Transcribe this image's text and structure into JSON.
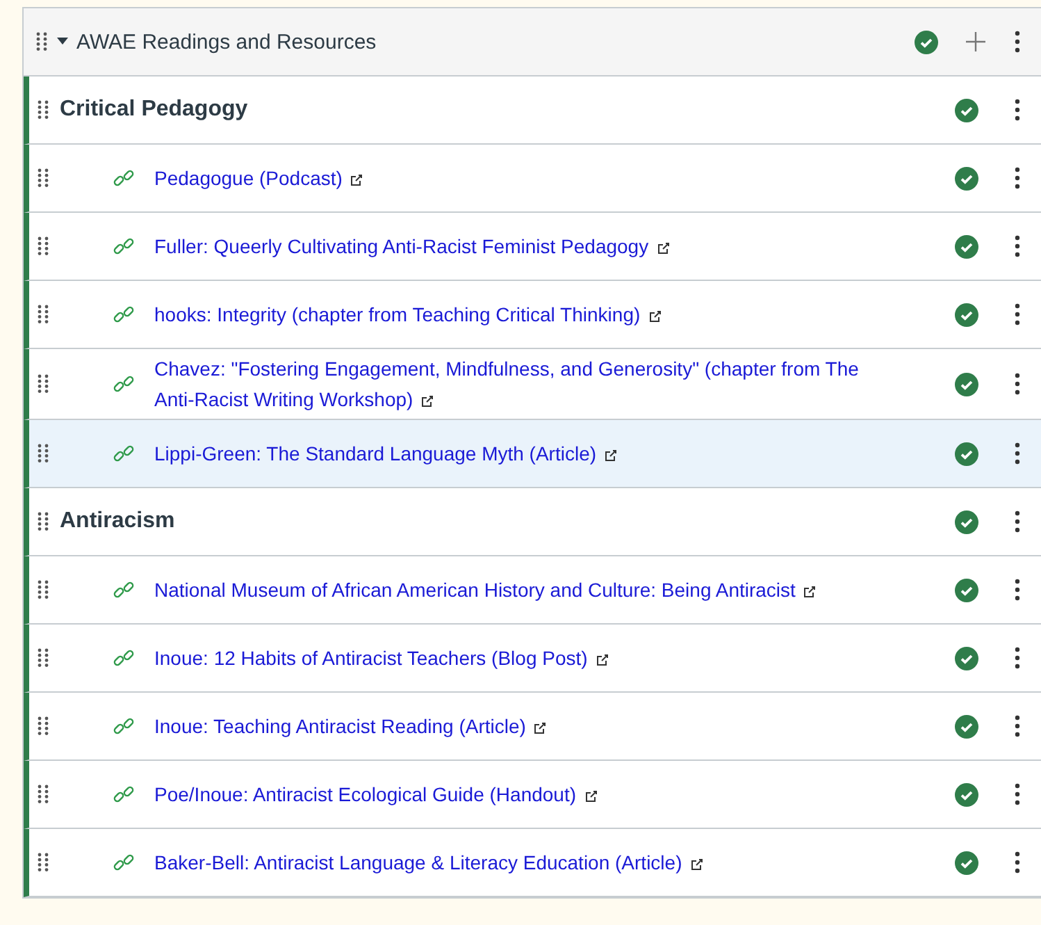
{
  "module": {
    "title": "AWAE Readings and Resources",
    "expanded": true,
    "published": true,
    "items": [
      {
        "kind": "subheader",
        "title": "Critical Pedagogy",
        "published": true,
        "selected": false
      },
      {
        "kind": "link",
        "title": "Pedagogue (Podcast)",
        "published": true,
        "selected": false
      },
      {
        "kind": "link",
        "title": "Fuller: Queerly Cultivating Anti-Racist Feminist Pedagogy",
        "published": true,
        "selected": false
      },
      {
        "kind": "link",
        "title": "hooks: Integrity (chapter from Teaching Critical Thinking)",
        "published": true,
        "selected": false
      },
      {
        "kind": "link",
        "title": "Chavez: \"Fostering Engagement, Mindfulness, and Generosity\" (chapter from The Anti-Racist Writing Workshop)",
        "published": true,
        "selected": false
      },
      {
        "kind": "link",
        "title": "Lippi-Green: The Standard Language Myth (Article)",
        "published": true,
        "selected": true
      },
      {
        "kind": "subheader",
        "title": "Antiracism",
        "published": true,
        "selected": false
      },
      {
        "kind": "link",
        "title": "National Museum of African American History and Culture: Being Antiracist",
        "published": true,
        "selected": false
      },
      {
        "kind": "link",
        "title": "Inoue: 12 Habits of Antiracist Teachers (Blog Post)",
        "published": true,
        "selected": false
      },
      {
        "kind": "link",
        "title": "Inoue: Teaching Antiracist Reading (Article)",
        "published": true,
        "selected": false
      },
      {
        "kind": "link",
        "title": "Poe/Inoue: Antiracist Ecological Guide (Handout)",
        "published": true,
        "selected": false
      },
      {
        "kind": "link",
        "title": "Baker-Bell: Antiracist Language & Literacy Education (Article)",
        "published": true,
        "selected": false
      }
    ]
  }
}
